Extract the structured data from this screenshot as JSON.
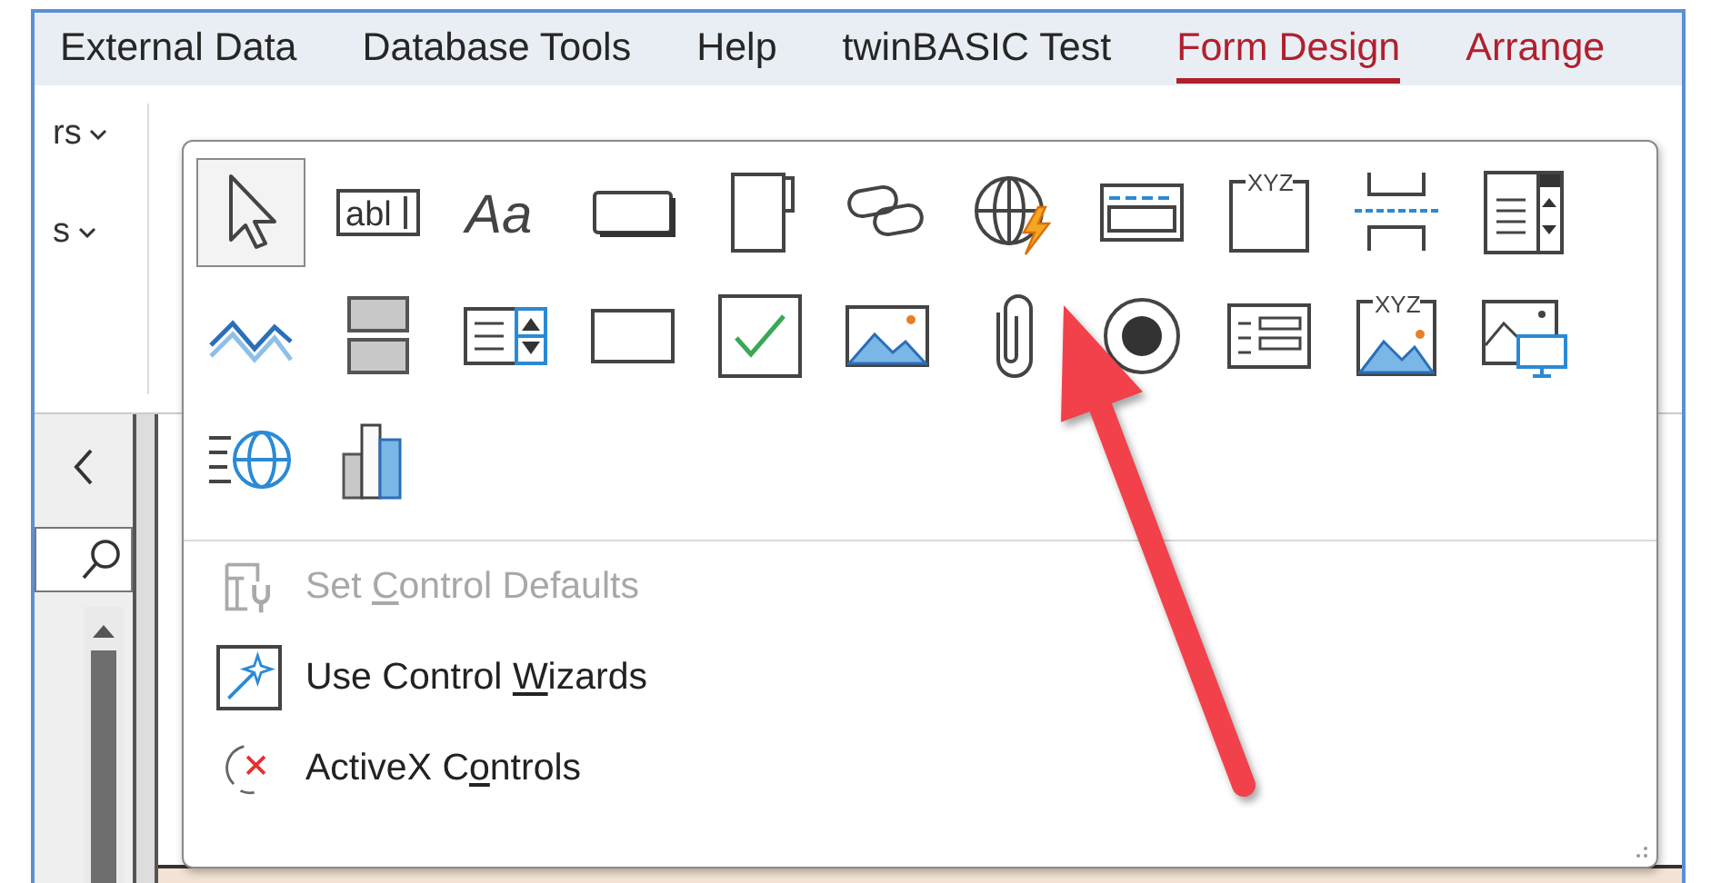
{
  "ribbon_tabs": [
    {
      "label": "External Data",
      "selected": false,
      "contextual": false
    },
    {
      "label": "Database Tools",
      "selected": false,
      "contextual": false
    },
    {
      "label": "Help",
      "selected": false,
      "contextual": false
    },
    {
      "label": "twinBASIC Test",
      "selected": false,
      "contextual": false
    },
    {
      "label": "Form Design",
      "selected": true,
      "contextual": true
    },
    {
      "label": "Arrange",
      "selected": false,
      "contextual": true
    }
  ],
  "ribbon_dropdowns": [
    {
      "label": "rs"
    },
    {
      "label": "s"
    }
  ],
  "controls_gallery": {
    "tools": [
      {
        "kind": "select",
        "selected": true
      },
      {
        "kind": "textbox",
        "glyph": "abl",
        "selected": false
      },
      {
        "kind": "label",
        "glyph": "Aa",
        "selected": false
      },
      {
        "kind": "button",
        "selected": false
      },
      {
        "kind": "tab",
        "selected": false
      },
      {
        "kind": "hyperlink",
        "selected": false
      },
      {
        "kind": "web_browser",
        "selected": false
      },
      {
        "kind": "navigation",
        "selected": false
      },
      {
        "kind": "option_group",
        "glyph": "XYZ",
        "selected": false
      },
      {
        "kind": "page_break",
        "selected": false
      },
      {
        "kind": "combo_box",
        "selected": false
      },
      {
        "kind": "line",
        "selected": false
      },
      {
        "kind": "toggle",
        "selected": false
      },
      {
        "kind": "list_box",
        "selected": false
      },
      {
        "kind": "rectangle",
        "selected": false
      },
      {
        "kind": "check_box",
        "selected": false
      },
      {
        "kind": "image",
        "selected": false
      },
      {
        "kind": "attachment",
        "selected": false
      },
      {
        "kind": "option_button",
        "selected": false
      },
      {
        "kind": "subform",
        "selected": false
      },
      {
        "kind": "bound_frame",
        "glyph": "XYZ",
        "selected": false
      },
      {
        "kind": "unbound_frame",
        "selected": false
      },
      {
        "kind": "edge_browser",
        "selected": false
      },
      {
        "kind": "chart",
        "selected": false
      }
    ],
    "menu": [
      {
        "kind": "defaults",
        "label_parts": [
          "Set ",
          "C",
          "ontrol Defaults"
        ],
        "disabled": true,
        "checked": false
      },
      {
        "kind": "wizards",
        "label_parts": [
          "Use Control ",
          "W",
          "izards"
        ],
        "disabled": false,
        "checked": true
      },
      {
        "kind": "activex",
        "label_parts": [
          "ActiveX C",
          "o",
          "ntrols"
        ],
        "disabled": false,
        "checked": false
      }
    ]
  }
}
